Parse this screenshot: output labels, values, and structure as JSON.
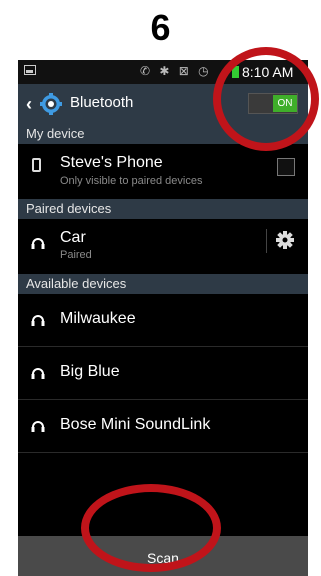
{
  "step_number": "6",
  "status_bar": {
    "time": "8:10 AM"
  },
  "action_bar": {
    "title": "Bluetooth",
    "toggle_label": "ON"
  },
  "sections": {
    "my_device": "My device",
    "paired": "Paired devices",
    "available": "Available devices"
  },
  "my_device": {
    "name": "Steve's Phone",
    "sub": "Only visible to paired devices"
  },
  "paired_devices": [
    {
      "name": "Car",
      "sub": "Paired"
    }
  ],
  "available_devices": [
    {
      "name": "Milwaukee"
    },
    {
      "name": "Big Blue"
    },
    {
      "name": "Bose Mini SoundLink"
    }
  ],
  "scan_label": "Scan",
  "colors": {
    "accent_green": "#3fae2a",
    "annotation_red": "#c0141a",
    "header_bg": "#2e3a46"
  }
}
